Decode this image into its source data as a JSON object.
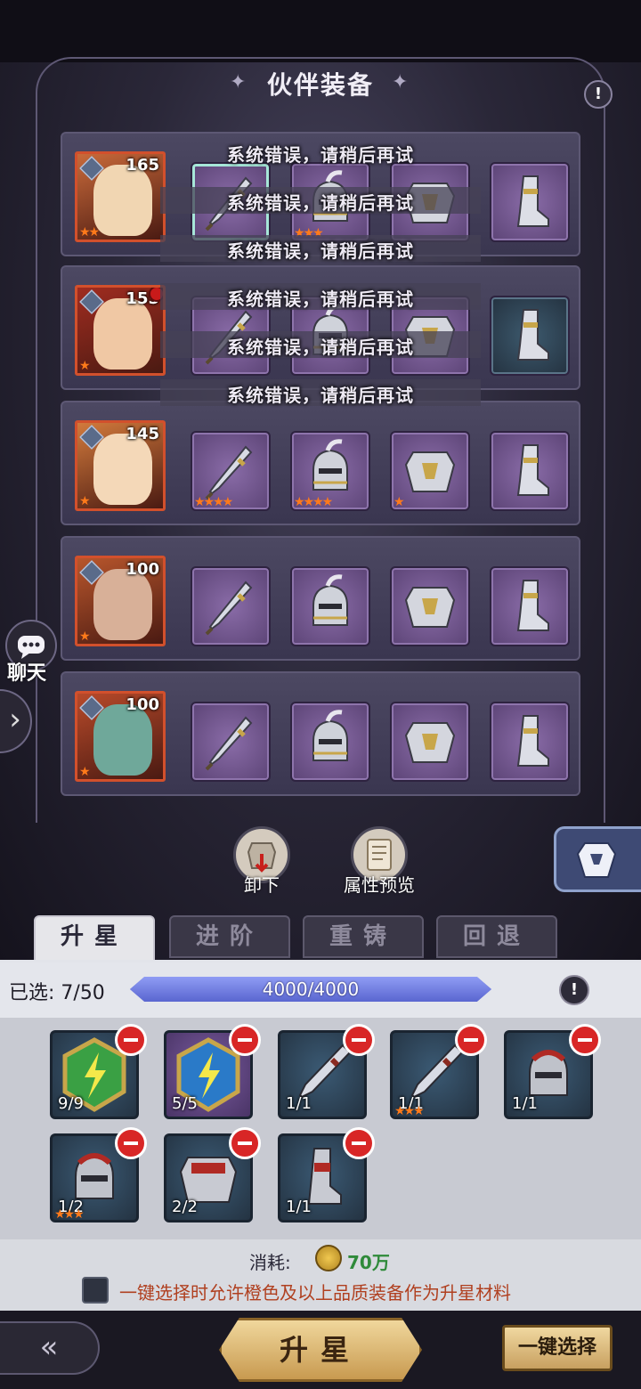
{
  "header": {
    "title": "伙伴装备",
    "help_icon": "exclamation-icon"
  },
  "errors": [
    "系统错误，请稍后再试",
    "系统错误，请稍后再试",
    "系统错误，请稍后再试",
    "系统错误，请稍后再试",
    "系统错误，请稍后再试",
    "系统错误，请稍后再试"
  ],
  "partners": [
    {
      "level": "165",
      "portrait_color": "#c96a3a",
      "stars": "★★",
      "slots": [
        {
          "item": "sword",
          "stars": "",
          "selected": true
        },
        {
          "item": "helmet",
          "stars": "★★★"
        },
        {
          "item": "armor",
          "stars": ""
        },
        {
          "item": "boots",
          "stars": ""
        }
      ]
    },
    {
      "level": "155",
      "portrait_color": "#a02c20",
      "stars": "★",
      "has_alert": true,
      "slots": [
        {
          "item": "sword",
          "stars": ""
        },
        {
          "item": "helmet",
          "stars": ""
        },
        {
          "item": "armor",
          "stars": ""
        },
        {
          "item": "boots",
          "stars": ""
        }
      ]
    },
    {
      "level": "145",
      "portrait_color": "#d27a3c",
      "stars": "★",
      "slots": [
        {
          "item": "sword",
          "stars": "★★★★"
        },
        {
          "item": "helmet",
          "stars": "★★★★"
        },
        {
          "item": "armor",
          "stars": "★"
        },
        {
          "item": "boots",
          "stars": ""
        }
      ]
    },
    {
      "level": "100",
      "portrait_color": "#b8562c",
      "stars": "★",
      "slots": [
        {
          "item": "sword",
          "stars": ""
        },
        {
          "item": "helmet",
          "stars": ""
        },
        {
          "item": "armor",
          "stars": ""
        },
        {
          "item": "boots",
          "stars": ""
        }
      ]
    },
    {
      "level": "100",
      "portrait_color": "#b84a2a",
      "stars": "★",
      "slots": [
        {
          "item": "sword",
          "stars": ""
        },
        {
          "item": "helmet",
          "stars": ""
        },
        {
          "item": "armor",
          "stars": ""
        },
        {
          "item": "boots",
          "stars": ""
        }
      ]
    }
  ],
  "sidebar": {
    "chat_label": "聊天",
    "chat_icon": "chat-bubble-icon",
    "expand_icon": "chevron-right-icon"
  },
  "actions": {
    "unequip_label": "卸下",
    "preview_label": "属性预览",
    "armor_icon": "armor-icon"
  },
  "tabs": [
    "升星",
    "进阶",
    "重铸",
    "回退"
  ],
  "active_tab": 0,
  "selection": {
    "label": "已选: 7/50",
    "progress_text": "4000/4000",
    "progress_fraction": 1.0
  },
  "materials": [
    {
      "type": "gem-green",
      "count": "9/9",
      "stars": ""
    },
    {
      "type": "gem-blue",
      "count": "5/5",
      "stars": ""
    },
    {
      "type": "dagger",
      "count": "1/1",
      "stars": ""
    },
    {
      "type": "dagger",
      "count": "1/1",
      "stars": "★★★"
    },
    {
      "type": "helmet-red",
      "count": "1/1",
      "stars": ""
    },
    {
      "type": "helmet-red",
      "count": "1/2",
      "stars": "★★★"
    },
    {
      "type": "armor-red",
      "count": "2/2",
      "stars": ""
    },
    {
      "type": "boots-red",
      "count": "1/1",
      "stars": ""
    }
  ],
  "cost": {
    "label": "消耗:",
    "value": "70万",
    "coin_icon": "gold-coin-icon"
  },
  "option": {
    "text": "一键选择时允许橙色及以上品质装备作为升星材料",
    "checked": false
  },
  "footer": {
    "back_icon": "back-arrow-icon",
    "star_up_label": "升星",
    "auto_select_label": "一键选择"
  },
  "colors": {
    "star": "#ff7a1a",
    "progress": "#5a6ad6",
    "remove": "#d82626",
    "cost_value": "#2f8a3a",
    "hint_text": "#b04020"
  }
}
